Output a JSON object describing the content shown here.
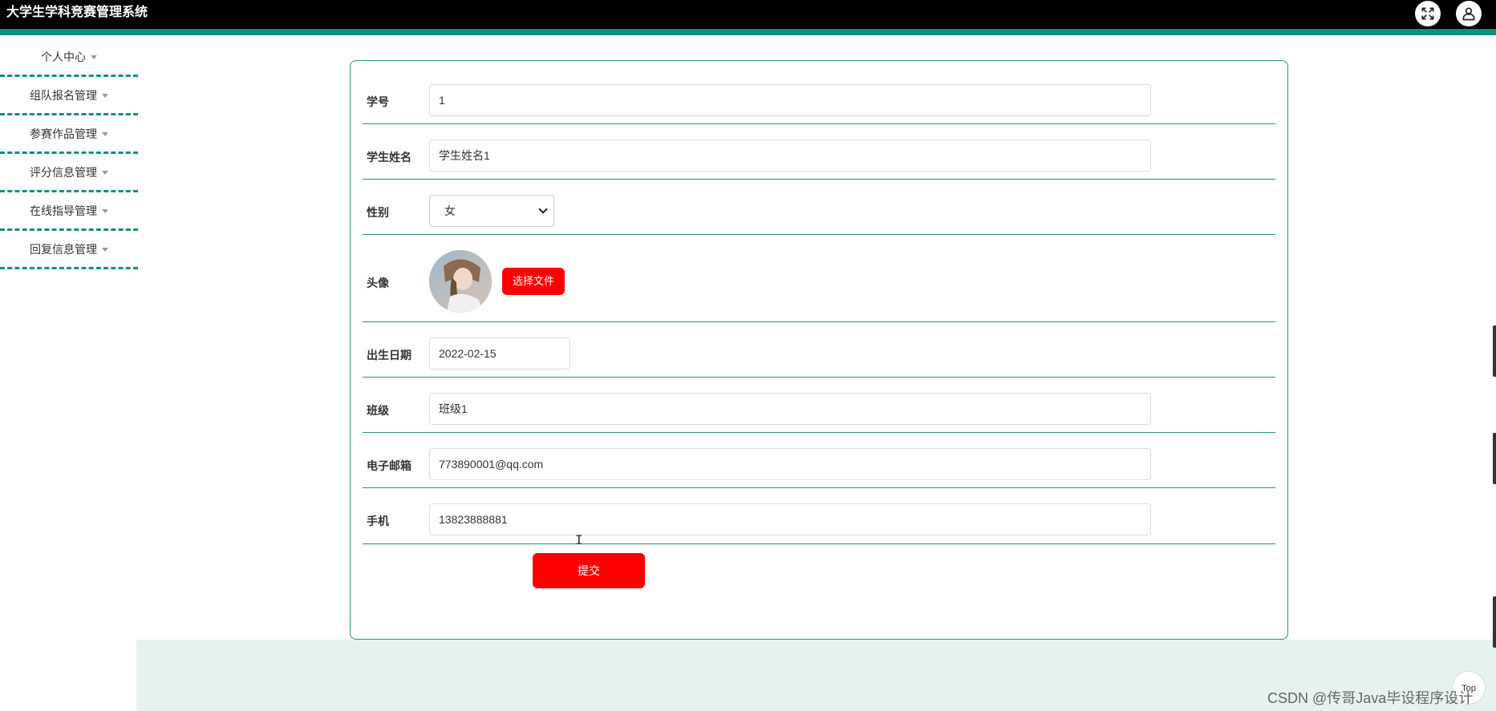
{
  "header": {
    "title": "大学生学科竞赛管理系统",
    "fullscreen_icon": "expand-icon",
    "user_icon": "user-icon"
  },
  "sidebar": {
    "items": [
      {
        "label": "个人中心"
      },
      {
        "label": "组队报名管理"
      },
      {
        "label": "参赛作品管理"
      },
      {
        "label": "评分信息管理"
      },
      {
        "label": "在线指导管理"
      },
      {
        "label": "回复信息管理"
      }
    ]
  },
  "form": {
    "student_id": {
      "label": "学号",
      "value": "1"
    },
    "student_name": {
      "label": "学生姓名",
      "value": "学生姓名1"
    },
    "gender": {
      "label": "性别",
      "value": "女"
    },
    "avatar": {
      "label": "头像",
      "button": "选择文件"
    },
    "birth_date": {
      "label": "出生日期",
      "value": "2022-02-15"
    },
    "class": {
      "label": "班级",
      "value": "班级1"
    },
    "email": {
      "label": "电子邮箱",
      "value": "773890001@qq.com"
    },
    "phone": {
      "label": "手机",
      "value": "13823888881"
    },
    "submit": "提交"
  },
  "back_to_top": "Top",
  "watermark": "CSDN @传哥Java毕设程序设计",
  "colors": {
    "accent": "#0f8f7e",
    "button": "#ff0000",
    "topbar": "#000000",
    "footer": "#e6f3ec"
  }
}
